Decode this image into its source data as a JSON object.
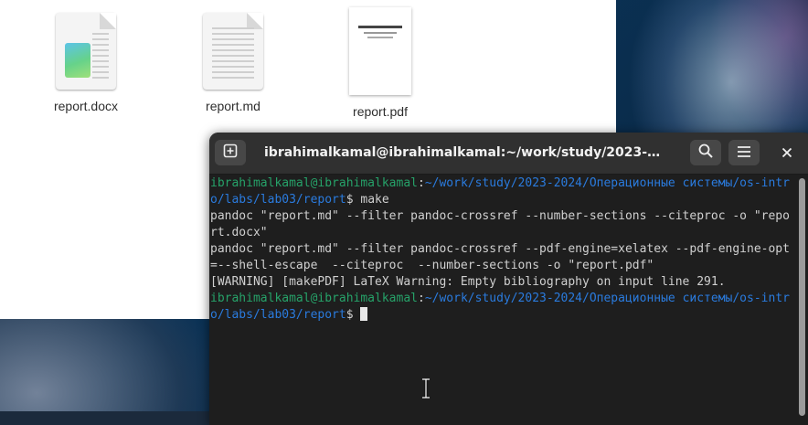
{
  "files": [
    {
      "name": "report.docx",
      "type": "docx"
    },
    {
      "name": "report.md",
      "type": "md"
    },
    {
      "name": "report.pdf",
      "type": "pdf"
    }
  ],
  "terminal": {
    "title": "ibrahimalkamal@ibrahimalkamal:~/work/study/2023-2024/Оп…",
    "lines": [
      {
        "user": "ibrahimalkamal@ibrahimalkamal",
        "sep": ":",
        "path": "~/work/study/2023-2024/Операционные системы/os-intro/labs/lab03/report",
        "cmd": "$ make"
      },
      {
        "text": "pandoc \"report.md\" --filter pandoc-crossref --number-sections --citeproc -o \"report.docx\""
      },
      {
        "text": "pandoc \"report.md\" --filter pandoc-crossref --pdf-engine=xelatex --pdf-engine-opt=--shell-escape  --citeproc  --number-sections -o \"report.pdf\""
      },
      {
        "text": "[WARNING] [makePDF] LaTeX Warning: Empty bibliography on input line 291."
      },
      {
        "user": "ibrahimalkamal@ibrahimalkamal",
        "sep": ":",
        "path": "~/work/study/2023-2024/Операционные системы/os-intro/labs/lab03/report",
        "cmd": "$ "
      }
    ]
  },
  "icons": {
    "new_tab": "new-tab-icon",
    "search": "search-icon",
    "menu": "hamburger-menu-icon",
    "close": "close-icon"
  },
  "colors": {
    "prompt_user": "#26a269",
    "prompt_path": "#2a7bde",
    "terminal_bg": "#1e1e1e"
  }
}
